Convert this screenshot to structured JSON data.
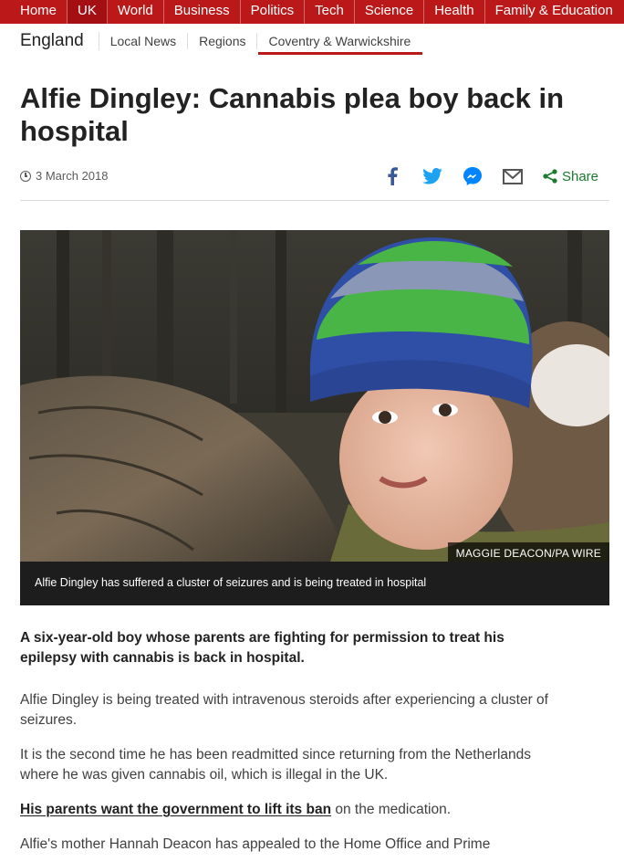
{
  "topnav": {
    "items": [
      "Home",
      "UK",
      "World",
      "Business",
      "Politics",
      "Tech",
      "Science",
      "Health",
      "Family & Education"
    ]
  },
  "subnav": {
    "region": "England",
    "links": [
      "Local News",
      "Regions",
      "Coventry & Warwickshire"
    ]
  },
  "article": {
    "headline": "Alfie Dingley: Cannabis plea boy back in hospital",
    "date": "3 March 2018",
    "share_label": "Share",
    "image_credit": "MAGGIE DEACON/PA WIRE",
    "image_caption": "Alfie Dingley has suffered a cluster of seizures and is being treated in hospital",
    "intro": "A six-year-old boy whose parents are fighting for permission to treat his epilepsy with cannabis is back in hospital.",
    "p1": "Alfie Dingley is being treated with intravenous steroids after experiencing a cluster of seizures.",
    "p2": "It is the second time he has been readmitted since returning from the Netherlands where he was given cannabis oil, which is illegal in the UK.",
    "p3_link": "His parents want the government to lift its ban",
    "p3_rest": " on the medication.",
    "p4": "Alfie's mother Hannah Deacon has appealed to the Home Office and Prime"
  },
  "icons": [
    "facebook-icon",
    "twitter-icon",
    "messenger-icon",
    "email-icon",
    "share-icon",
    "clock-icon"
  ],
  "colors": {
    "brand_red": "#bb1919",
    "share_green": "#1a7a2f",
    "facebook": "#3b5998",
    "twitter": "#1da1f2",
    "messenger": "#0084ff"
  }
}
